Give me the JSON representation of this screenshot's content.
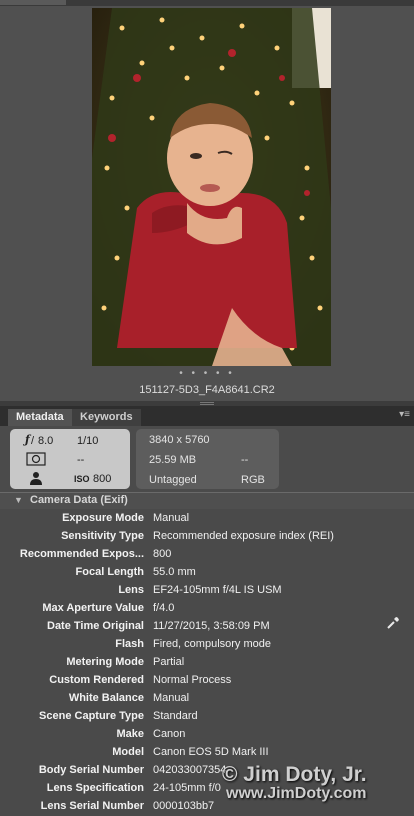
{
  "preview": {
    "filename": "151127-5D3_F4A8641.CR2",
    "page_dots": "• • • • •"
  },
  "panel": {
    "tabs": [
      {
        "label": "Metadata",
        "active": true
      },
      {
        "label": "Keywords",
        "active": false
      }
    ],
    "menu_icon": "panel-menu-icon"
  },
  "exposure": {
    "aperture_icon": "f-aperture-icon",
    "aperture": "8.0",
    "shutter": "1/10",
    "metering_icon": "metering-mode-icon",
    "metering_value": "--",
    "person_icon": "person-icon",
    "iso_value": "800"
  },
  "file_info": {
    "dimensions": "3840 x 5760",
    "size": "25.59 MB",
    "size_right": "--",
    "tag": "Untagged",
    "color_mode": "RGB"
  },
  "section": {
    "title": "Camera Data (Exif)"
  },
  "camera_data": [
    {
      "label": "Exposure Mode",
      "value": "Manual"
    },
    {
      "label": "Sensitivity Type",
      "value": "Recommended exposure index (REI)"
    },
    {
      "label": "Recommended Expos...",
      "value": "800"
    },
    {
      "label": "Focal Length",
      "value": "55.0 mm"
    },
    {
      "label": "Lens",
      "value": "EF24-105mm f/4L IS USM"
    },
    {
      "label": "Max Aperture Value",
      "value": "f/4.0"
    },
    {
      "label": "Date Time Original",
      "value": "11/27/2015, 3:58:09 PM"
    },
    {
      "label": "Flash",
      "value": "Fired, compulsory mode"
    },
    {
      "label": "Metering Mode",
      "value": "Partial"
    },
    {
      "label": "Custom Rendered",
      "value": "Normal Process"
    },
    {
      "label": "White Balance",
      "value": "Manual"
    },
    {
      "label": "Scene Capture Type",
      "value": "Standard"
    },
    {
      "label": "Make",
      "value": "Canon"
    },
    {
      "label": "Model",
      "value": "Canon EOS 5D Mark III"
    },
    {
      "label": "Body Serial Number",
      "value": "042033007354"
    },
    {
      "label": "Lens Specification",
      "value": "24-105mm f/0"
    },
    {
      "label": "Lens Serial Number",
      "value": "0000103bb7"
    }
  ],
  "watermark": {
    "line1": "© Jim Doty, Jr.",
    "line2": "www.JimDoty.com"
  }
}
